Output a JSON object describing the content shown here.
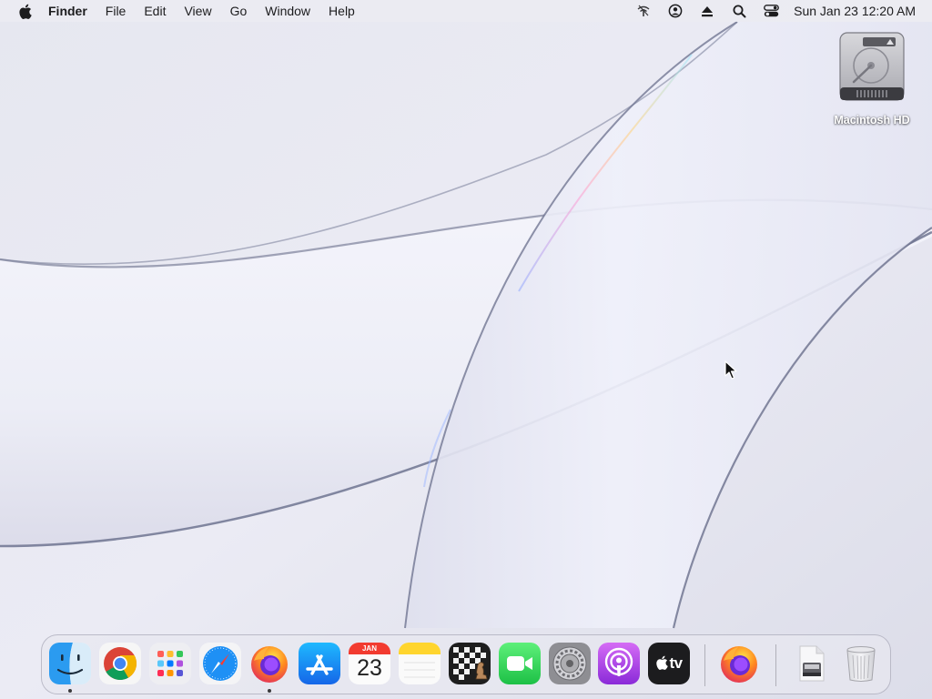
{
  "menubar": {
    "apple_icon": "apple-logo-icon",
    "app_name": "Finder",
    "items": [
      "File",
      "Edit",
      "View",
      "Go",
      "Window",
      "Help"
    ],
    "status_icons": [
      "wifi-off-icon",
      "user-account-icon",
      "eject-icon",
      "spotlight-search-icon",
      "control-center-icon"
    ],
    "clock": "Sun Jan 23  12:20 AM"
  },
  "desktop": {
    "icons": [
      {
        "label": "Macintosh HD",
        "icon": "hard-drive-icon"
      }
    ]
  },
  "dock": {
    "apps": [
      {
        "name": "Finder",
        "icon": "finder-icon",
        "running": true
      },
      {
        "name": "Google Chrome",
        "icon": "chrome-icon",
        "running": false
      },
      {
        "name": "Launchpad",
        "icon": "launchpad-icon",
        "running": false
      },
      {
        "name": "Safari",
        "icon": "safari-icon",
        "running": false
      },
      {
        "name": "Firefox",
        "icon": "firefox-icon",
        "running": true
      },
      {
        "name": "App Store",
        "icon": "app-store-icon",
        "running": false
      },
      {
        "name": "Calendar",
        "icon": "calendar-icon",
        "running": false,
        "month": "JAN",
        "day": "23"
      },
      {
        "name": "Notes",
        "icon": "notes-icon",
        "running": false
      },
      {
        "name": "Chess",
        "icon": "chess-icon",
        "running": false
      },
      {
        "name": "FaceTime",
        "icon": "facetime-icon",
        "running": false
      },
      {
        "name": "System Preferences",
        "icon": "system-preferences-icon",
        "running": false
      },
      {
        "name": "Podcasts",
        "icon": "podcasts-icon",
        "running": false
      },
      {
        "name": "Apple TV",
        "icon": "apple-tv-icon",
        "running": false,
        "label": "tv"
      }
    ],
    "recent": [
      {
        "name": "Firefox",
        "icon": "firefox-icon"
      }
    ],
    "extras": [
      {
        "name": "Downloads",
        "icon": "downloads-stack-icon"
      },
      {
        "name": "Trash",
        "icon": "trash-icon"
      }
    ]
  },
  "colors": {
    "menubar_bg": "#ececf2",
    "wallpaper_light": "#f1f1f8",
    "wallpaper_shadow": "#6f7490",
    "calendar_red": "#f23b30"
  }
}
